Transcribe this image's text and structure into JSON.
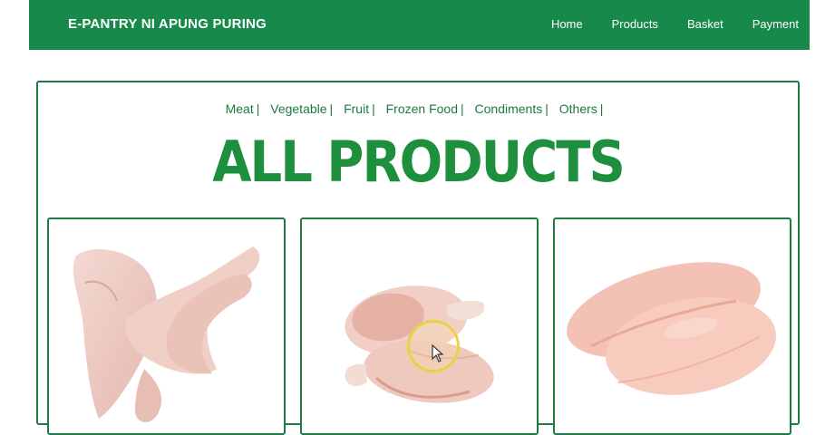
{
  "header": {
    "brand": "E-PANTRY NI APUNG PURING",
    "nav": [
      "Home",
      "Products",
      "Basket",
      "Payment"
    ]
  },
  "categories": [
    "Meat",
    "Vegetable",
    "Fruit",
    "Frozen Food",
    "Condiments",
    "Others"
  ],
  "category_separator": "|",
  "page_title": "ALL PRODUCTS",
  "products": [
    {
      "image": "raw-chicken-wings-image"
    },
    {
      "image": "raw-chicken-drumsticks-image"
    },
    {
      "image": "raw-chicken-breast-image"
    }
  ],
  "colors": {
    "brand_green": "#17894a",
    "title_green": "#1e8f3c",
    "border_green": "#1f7a44",
    "cursor_highlight": "#e7d341"
  }
}
